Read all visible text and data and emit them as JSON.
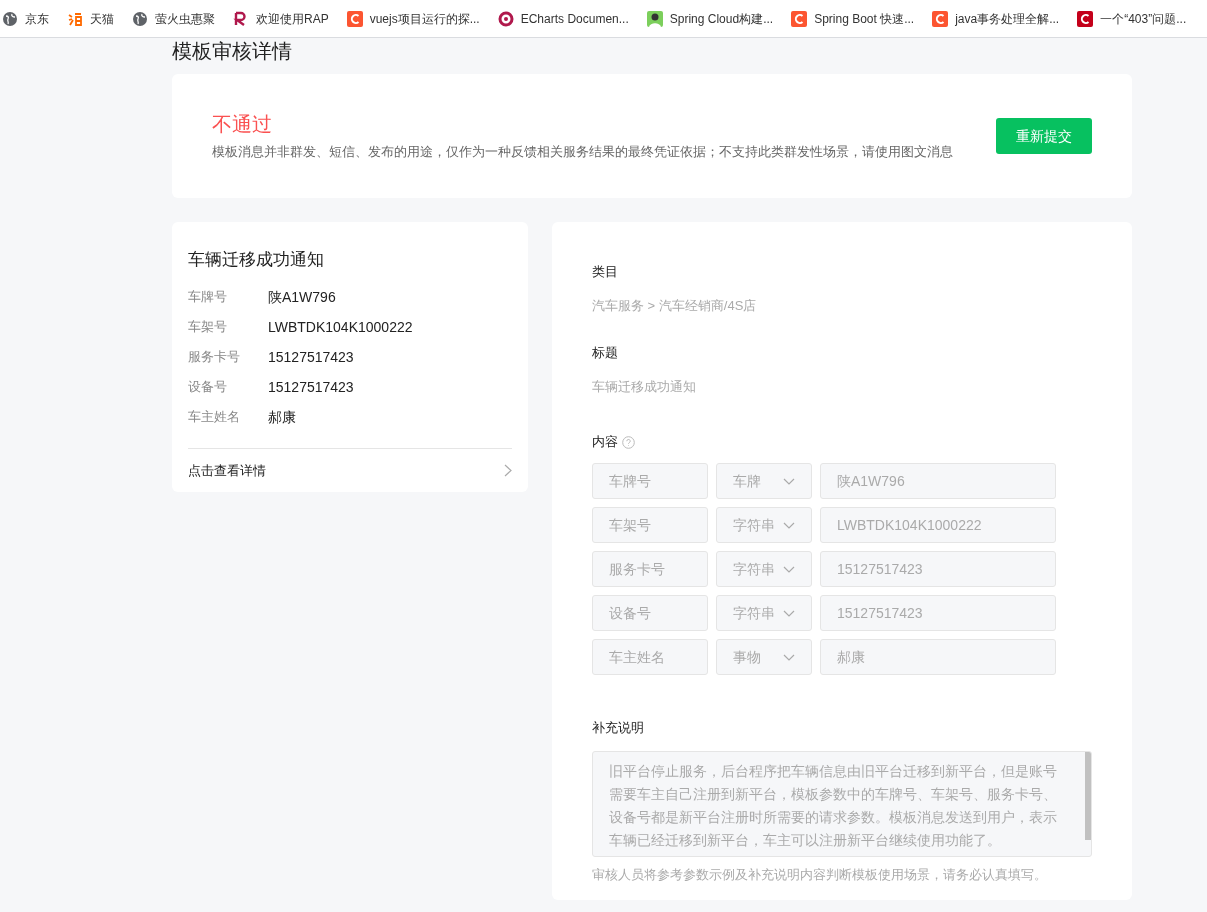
{
  "bookmarks": [
    {
      "label": "京东",
      "kind": "globe",
      "color": "#5f6368"
    },
    {
      "label": "天猫",
      "kind": "squiggle",
      "color": "#ff6a00"
    },
    {
      "label": "萤火虫惠聚",
      "kind": "globe",
      "color": "#5f6368"
    },
    {
      "label": "欢迎使用RAP",
      "kind": "mark",
      "color": "#b0184c"
    },
    {
      "label": "vuejs项目运行的探...",
      "kind": "tile",
      "color": "#fc5531"
    },
    {
      "label": "ECharts Documen...",
      "kind": "ring",
      "color": "#b0184c"
    },
    {
      "label": "Spring Cloud构建...",
      "kind": "avatar",
      "color": "#7ccf5c"
    },
    {
      "label": "Spring Boot 快速...",
      "kind": "tile",
      "color": "#fc5531"
    },
    {
      "label": "java事务处理全解...",
      "kind": "tile",
      "color": "#fc5531"
    },
    {
      "label": "一个“403”问题...",
      "kind": "tile",
      "color": "#c4001a"
    }
  ],
  "page_title": "模板审核详情",
  "review": {
    "status": "不通过",
    "reason": "模板消息并非群发、短信、发布的用途，仅作为一种反馈相关服务结果的最终凭证依据；不支持此类群发性场景，请使用图文消息",
    "button": "重新提交"
  },
  "preview": {
    "title": "车辆迁移成功通知",
    "fields": [
      {
        "label": "车牌号",
        "value": "陕A1W796"
      },
      {
        "label": "车架号",
        "value": "LWBTDK104K1000222"
      },
      {
        "label": "服务卡号",
        "value": "15127517423"
      },
      {
        "label": "设备号",
        "value": "15127517423"
      },
      {
        "label": "车主姓名",
        "value": "郝康"
      }
    ],
    "link": "点击查看详情"
  },
  "details": {
    "category_label": "类目",
    "category": "汽车服务 > 汽车经销商/4S店",
    "title_label": "标题",
    "title": "车辆迁移成功通知",
    "content_label": "内容",
    "params": [
      {
        "name": "车牌号",
        "type": "车牌",
        "example": "陕A1W796"
      },
      {
        "name": "车架号",
        "type": "字符串",
        "example": "LWBTDK104K1000222"
      },
      {
        "name": "服务卡号",
        "type": "字符串",
        "example": "15127517423"
      },
      {
        "name": "设备号",
        "type": "字符串",
        "example": "15127517423"
      },
      {
        "name": "车主姓名",
        "type": "事物",
        "example": "郝康"
      }
    ],
    "note_label": "补充说明",
    "note": "旧平台停止服务，后台程序把车辆信息由旧平台迁移到新平台，但是账号需要车主自己注册到新平台，模板参数中的车牌号、车架号、服务卡号、设备号都是新平台注册时所需要的请求参数。模板消息发送到用户，表示车辆已经迁移到新平台，车主可以注册新平台继续使用功能了。",
    "hint": "审核人员将参考参数示例及补充说明内容判断模板使用场景，请务必认真填写。"
  }
}
